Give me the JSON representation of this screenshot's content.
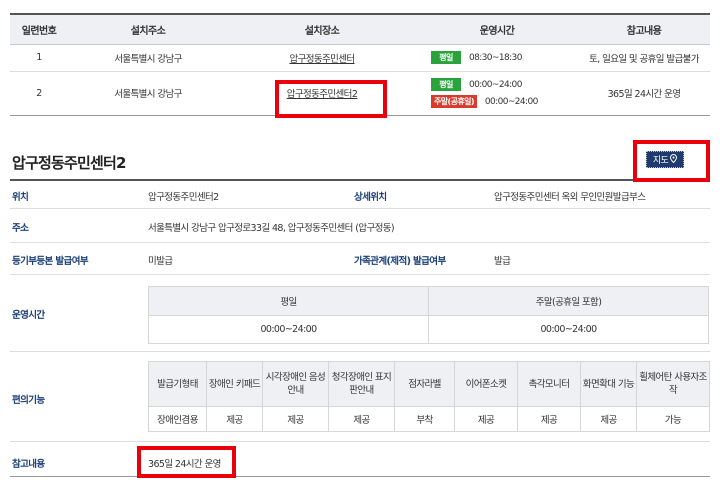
{
  "top_table": {
    "headers": [
      "일련번호",
      "설치주소",
      "설치장소",
      "운영시간",
      "참고내용"
    ],
    "rows": [
      {
        "no": "1",
        "address": "서울특별시 강남구",
        "place": "압구정동주민센터",
        "hours": [
          {
            "badge": "평일",
            "time": "08:30~18:30",
            "color": "#2aa33c"
          }
        ],
        "note": "토, 일요일 및 공휴일 발급불가"
      },
      {
        "no": "2",
        "address": "서울특별시 강남구",
        "place": "압구정동주민센터2",
        "hours": [
          {
            "badge": "평일",
            "time": "00:00~24:00",
            "color": "#2aa33c"
          },
          {
            "badge": "주말(공휴일)",
            "time": "00:00~24:00",
            "color": "#d93a2b"
          }
        ],
        "note": "365일 24시간 운영"
      }
    ]
  },
  "detail": {
    "title": "압구정동주민센터2",
    "map_button": "지도",
    "map_icon": "map-pin-icon",
    "location_label": "위치",
    "location_value": "압구정동주민센터2",
    "detail_location_label": "상세위치",
    "detail_location_value": "압구정동주민센터 옥외 무인민원발급부스",
    "address_label": "주소",
    "address_value": "서울특별시 강남구 압구정로33길 48, 압구정동주민센터 (압구정동)",
    "register_label": "등기부등본 발급여부",
    "register_value": "미발급",
    "family_label": "가족관계(제적) 발급여부",
    "family_value": "발급",
    "hours_label": "운영시간",
    "hours_headers": [
      "평일",
      "주말(공휴일 포함)"
    ],
    "hours_values": [
      "00:00~24:00",
      "00:00~24:00"
    ],
    "features_label": "편의기능",
    "features_headers": [
      "발급기형태",
      "장애인 키패드",
      "시각장애인 음성안내",
      "청각장애인 표지판안내",
      "점자라벨",
      "이어폰소켓",
      "촉각모니터",
      "화면확대 기능",
      "휠체어탄 사용자조작"
    ],
    "features_values": [
      "장애인겸용",
      "제공",
      "제공",
      "제공",
      "부착",
      "제공",
      "제공",
      "제공",
      "가능"
    ],
    "note_label": "참고내용",
    "note_value": "365일 24시간 운영"
  },
  "colors": {
    "header_bg": "#eef0f4",
    "label_blue": "#1a3e7a",
    "map_button_bg": "#1f3a6d",
    "highlight_red": "#e8000a",
    "badge_green": "#2aa33c",
    "badge_red": "#d93a2b"
  }
}
